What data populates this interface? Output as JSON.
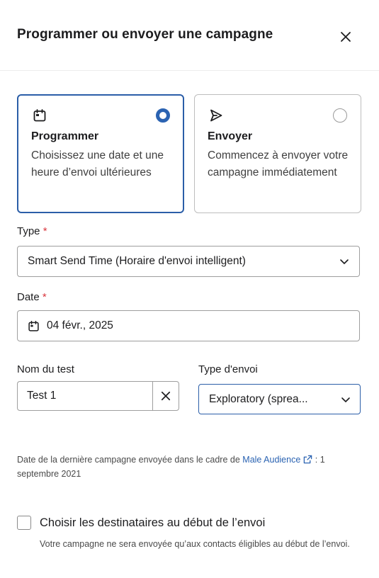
{
  "dialog": {
    "title": "Programmer ou envoyer une campagne"
  },
  "options": [
    {
      "icon": "calendar-icon",
      "title": "Programmer",
      "description": "Choisissez une date et une heure d’envoi ultérieures",
      "selected": true
    },
    {
      "icon": "send-icon",
      "title": "Envoyer",
      "description": "Commencez à envoyer votre campagne immédiatement",
      "selected": false
    }
  ],
  "form": {
    "type_label": "Type",
    "type_value": "Smart Send Time (Horaire d'envoi intelligent)",
    "date_label": "Date",
    "date_value": "04 févr., 2025",
    "required_marker": "*",
    "test_name_label": "Nom du test",
    "test_name_value": "Test 1",
    "send_type_label": "Type d'envoi",
    "send_type_value": "Exploratory (sprea..."
  },
  "info": {
    "prefix": "Date de la dernière campagne envoyée dans le cadre de ",
    "link_text": "Male Audience",
    "suffix": " : 1 septembre 2021"
  },
  "recipients": {
    "checkbox_label": "Choisir les destinataires au début de l’envoi",
    "help_text": "Votre campagne ne sera envoyée qu’aux contacts éligibles au début de l’envoi.",
    "checked": false
  },
  "colors": {
    "accent": "#2b5ea8",
    "required": "#d9363e",
    "link": "#2b63b2"
  }
}
